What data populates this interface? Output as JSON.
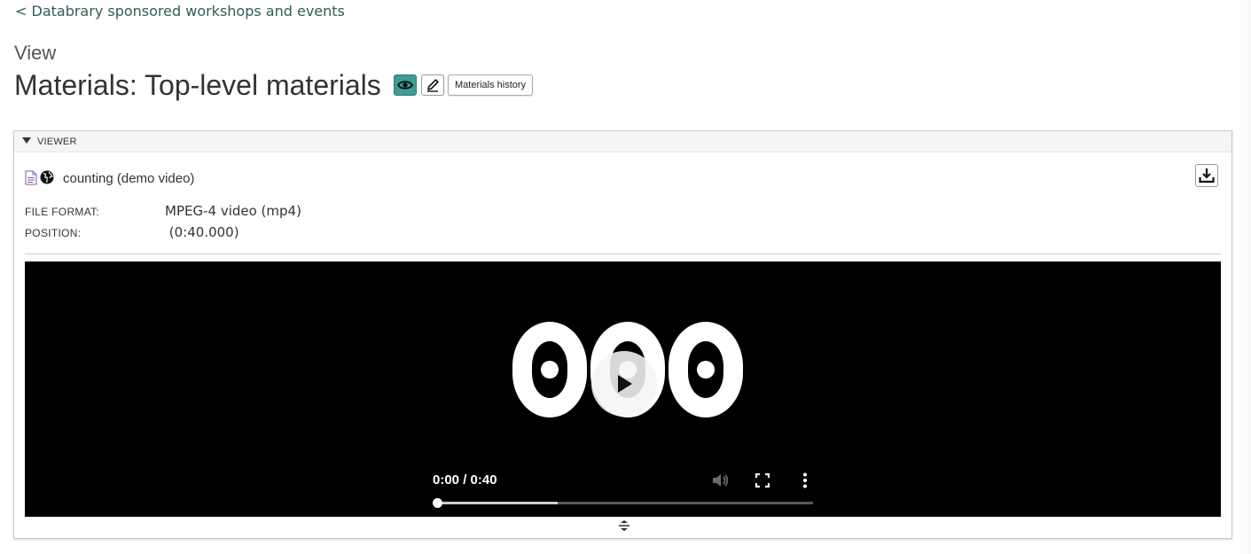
{
  "breadcrumb": {
    "label": "< Databrary sponsored workshops and events"
  },
  "header": {
    "view_label": "View",
    "title": "Materials: Top-level materials",
    "history_button": "Materials history"
  },
  "viewer": {
    "section_label": "VIEWER",
    "asset": {
      "name": "counting (demo video)",
      "file_icon": "mp4-file-icon",
      "access_icon": "globe-icon"
    },
    "meta": [
      {
        "label": "FILE FORMAT:",
        "value": "MPEG-4 video (mp4)"
      },
      {
        "label": "POSITION:",
        "value": " (0:40.000)"
      }
    ],
    "player": {
      "time": "0:00 / 0:40",
      "buffered_fraction": 0.32,
      "played_fraction": 0.0,
      "icons": [
        "play-icon",
        "volume-muted-icon",
        "fullscreen-icon",
        "more-options-icon"
      ]
    }
  },
  "colors": {
    "accent": "#3f9b93",
    "link": "#2e5e5a",
    "video_bg": "#000000"
  }
}
